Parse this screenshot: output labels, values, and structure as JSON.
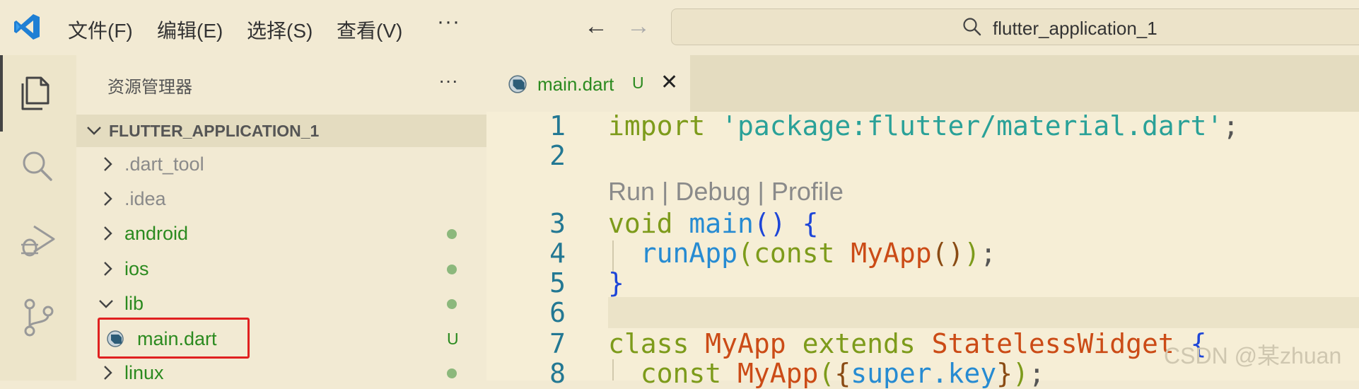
{
  "titlebar": {
    "menu": [
      "文件(F)",
      "编辑(E)",
      "选择(S)",
      "查看(V)"
    ],
    "more": "···",
    "back_arrow": "←",
    "forward_arrow": "→",
    "search_text": "flutter_application_1"
  },
  "sidebar": {
    "title": "资源管理器",
    "more": "···",
    "folder": "FLUTTER_APPLICATION_1",
    "items": [
      {
        "label": ".dart_tool",
        "status": ""
      },
      {
        "label": ".idea",
        "status": ""
      },
      {
        "label": "android",
        "status": "dot"
      },
      {
        "label": "ios",
        "status": "dot"
      },
      {
        "label": "lib",
        "status": "dot"
      },
      {
        "label": "main.dart",
        "status": "U"
      },
      {
        "label": "linux",
        "status": "dot"
      }
    ]
  },
  "editor": {
    "tab": {
      "label": "main.dart",
      "badge": "U",
      "close": "✕"
    },
    "codelens": "Run | Debug | Profile",
    "line_numbers": [
      "1",
      "2",
      "3",
      "4",
      "5",
      "6",
      "7",
      "8"
    ],
    "code": {
      "l1_kw": "import",
      "l1_str": "'package:flutter/material.dart'",
      "l1_end": ";",
      "l3_kw": "void",
      "l3_fn": "main",
      "l3_parens": "()",
      "l3_brace": "{",
      "l4_fn": "runApp",
      "l4_open": "(",
      "l4_kw": "const",
      "l4_cls": "MyApp",
      "l4_inner": "()",
      "l4_close": ")",
      "l4_end": ";",
      "l5_brace": "}",
      "l7_kw1": "class",
      "l7_cls1": "MyApp",
      "l7_kw2": "extends",
      "l7_cls2": "StatelessWidget",
      "l7_brace": "{",
      "l8_kw": "const",
      "l8_cls": "MyApp",
      "l8_open": "(",
      "l8_brace_open": "{",
      "l8_super": "super.key",
      "l8_brace_close": "}",
      "l8_close": ")",
      "l8_end": ";"
    }
  },
  "watermark": "CSDN @某zhuan",
  "colors": {
    "background": "#f2ead3",
    "accent_green": "#2b8a1f",
    "selection_red": "#e02020",
    "line_number": "#237893"
  }
}
